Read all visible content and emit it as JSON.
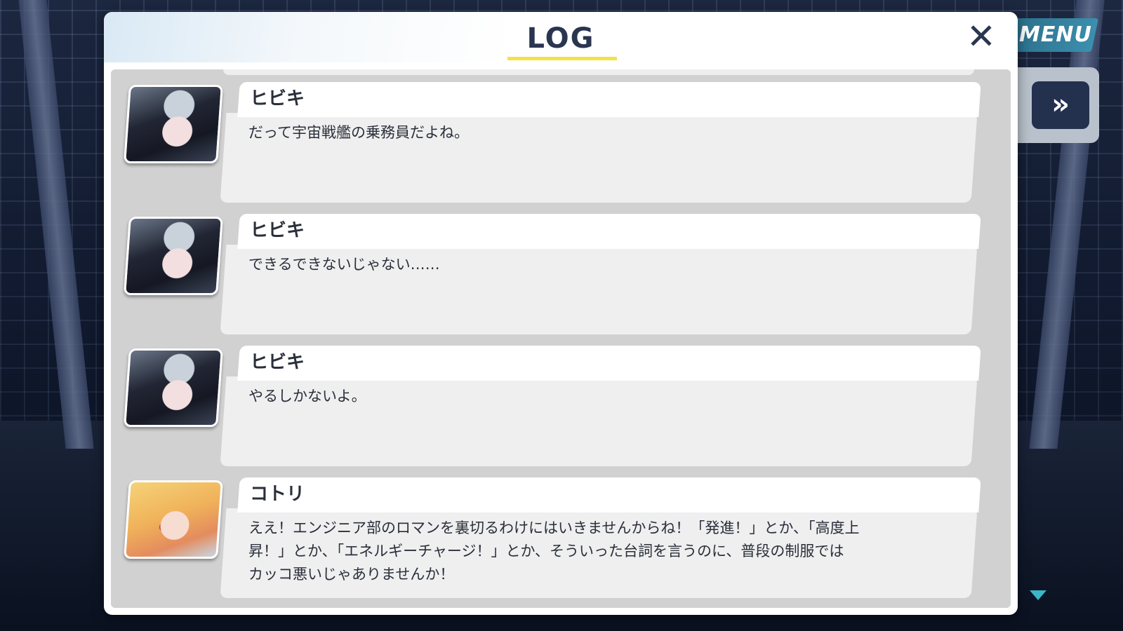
{
  "top_controls": {
    "menu_label": "MENU",
    "fast_forward_icon": "fast-forward-icon",
    "fast_forward_glyph": "»",
    "scroll_down_icon": "triangle-down-icon"
  },
  "log_panel": {
    "title": "LOG",
    "close_glyph": "✕",
    "close_icon": "close-icon"
  },
  "entries": [
    {
      "speaker": "ヒビキ",
      "avatar": "hibiki-portrait",
      "text": "だって宇宙戦艦の乗務員だよね。"
    },
    {
      "speaker": "ヒビキ",
      "avatar": "hibiki-portrait",
      "text": "できるできないじゃない……"
    },
    {
      "speaker": "ヒビキ",
      "avatar": "hibiki-portrait",
      "text": "やるしかないよ。"
    },
    {
      "speaker": "コトリ",
      "avatar": "kotori-portrait",
      "text_lines": [
        "ええ！エンジニア部のロマンを裏切るわけにはいきませんからね！「発進！」とか、「高度上",
        "昇！」とか、「エネルギーチャージ！」とか、そういった台詞を言うのに、普段の制服では",
        "カッコ悪いじゃありませんか！"
      ]
    }
  ],
  "colors": {
    "title_underline": "#f2e24a",
    "menu_accent": "#3c8fae",
    "ff_button": "#23314f",
    "text": "#2a2f3a",
    "list_bg": "#d1d1d1"
  }
}
